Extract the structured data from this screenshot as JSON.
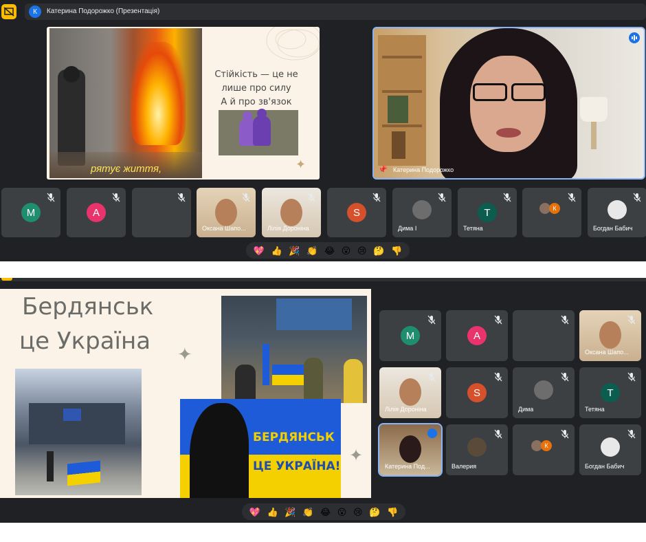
{
  "top": {
    "presenter_chip_initial": "К",
    "presenter_chip_label": "Катерина Подорожко (Презентація)",
    "slide": {
      "line1": "Стійкість — це не",
      "line2": "лише про силу",
      "line3": "А й про зв'язок",
      "caption": "рятує життя,"
    },
    "speaker_name": "Катерина Подорожко",
    "participants": [
      {
        "initial": "M",
        "name": "",
        "color": "#1e8e6e"
      },
      {
        "initial": "A",
        "name": "",
        "color": "#e8336d"
      },
      {
        "initial": "",
        "name": "",
        "color": ""
      },
      {
        "initial": "",
        "name": "Оксана Шапо...",
        "color": ""
      },
      {
        "initial": "",
        "name": "Лілія Доронiна",
        "color": ""
      },
      {
        "initial": "S",
        "name": "",
        "color": "#d5502b"
      },
      {
        "initial": "",
        "name": "Дима І",
        "color": ""
      },
      {
        "initial": "T",
        "name": "Тетяна",
        "color": "#0b5d4f"
      },
      {
        "initial": "К",
        "name": "",
        "color": "#e8710a"
      },
      {
        "initial": "",
        "name": "Богдан Бабич",
        "color": ""
      }
    ],
    "reactions": [
      "💖",
      "👍",
      "🎉",
      "👏",
      "😂",
      "😮",
      "😢",
      "🤔",
      "👎"
    ]
  },
  "bottom": {
    "slide": {
      "title_line1": "Бердянськ",
      "title_line2": "це Україна",
      "banner_line1": "БЕРДЯНСЬК",
      "banner_line2": "ЦЕ УКРАЇНА!"
    },
    "participants": [
      {
        "initial": "M",
        "name": "",
        "color": "#1e8e6e"
      },
      {
        "initial": "A",
        "name": "",
        "color": "#e8336d"
      },
      {
        "initial": "",
        "name": "",
        "color": ""
      },
      {
        "initial": "",
        "name": "Оксана Шапо...",
        "color": ""
      },
      {
        "initial": "",
        "name": "Лілія Доронiна",
        "color": ""
      },
      {
        "initial": "S",
        "name": "",
        "color": "#d5502b"
      },
      {
        "initial": "",
        "name": "Дима",
        "color": ""
      },
      {
        "initial": "T",
        "name": "Тетяна",
        "color": "#0b5d4f"
      },
      {
        "initial": "",
        "name": "Катерина Под...",
        "color": ""
      },
      {
        "initial": "",
        "name": "Валерия",
        "color": ""
      },
      {
        "initial": "К",
        "name": "",
        "color": "#e8710a"
      },
      {
        "initial": "",
        "name": "Богдан Бабич",
        "color": ""
      }
    ],
    "reactions": [
      "💖",
      "👍",
      "🎉",
      "👏",
      "😂",
      "😮",
      "😢",
      "🤔",
      "👎"
    ]
  },
  "colors": {
    "panel": "#202124",
    "tile": "#3c4043",
    "accent": "#8ab4f8",
    "slide_bg": "#fbf3e8"
  }
}
